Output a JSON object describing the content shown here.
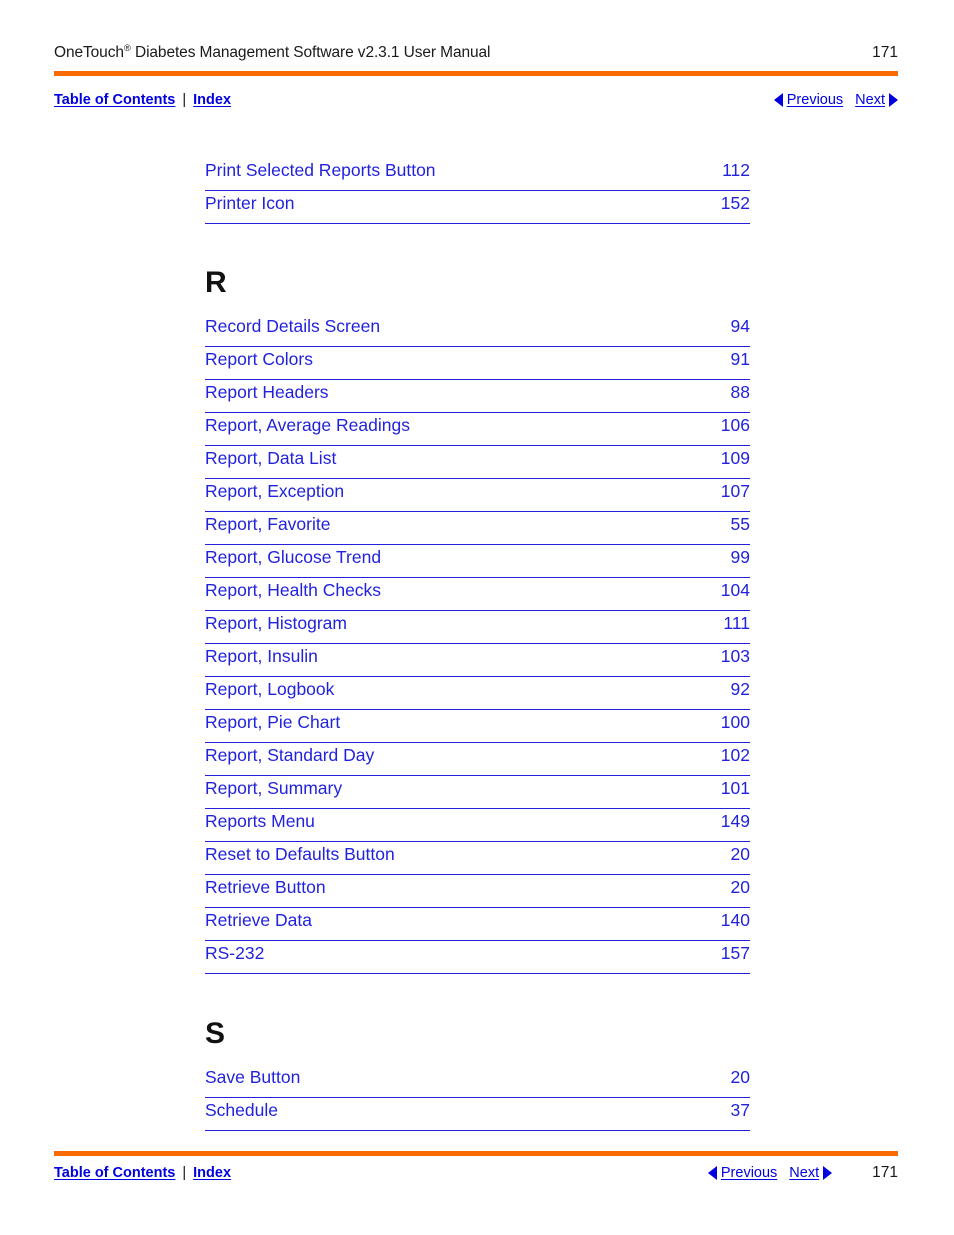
{
  "header": {
    "title_main": "OneTouch",
    "title_sup": "®",
    "title_rest": " Diabetes Management Software v2.3.1 User Manual",
    "page_number": "171"
  },
  "nav": {
    "toc_label": "Table of Contents",
    "separator": "|",
    "index_label": "Index",
    "previous_label": "Previous",
    "next_label": "Next",
    "prev_icon": "triangle-left-icon",
    "next_icon": "triangle-right-icon"
  },
  "footer": {
    "toc_label": "Table of Contents",
    "separator": "|",
    "index_label": "Index",
    "previous_label": "Previous",
    "next_label": "Next",
    "page_number": "171"
  },
  "colors": {
    "rule_orange": "#f96a00",
    "entry_blue": "#2222dd",
    "link_blue": "#0000e0",
    "text_black": "#1a1a1a"
  },
  "index": {
    "leading_entries": [
      {
        "label": "Print Selected Reports Button",
        "page": "112"
      },
      {
        "label": "Printer Icon",
        "page": "152"
      }
    ],
    "sections": [
      {
        "letter": "R",
        "entries": [
          {
            "label": "Record Details Screen",
            "page": "94"
          },
          {
            "label": "Report Colors",
            "page": "91"
          },
          {
            "label": "Report Headers",
            "page": "88"
          },
          {
            "label": "Report, Average Readings",
            "page": "106"
          },
          {
            "label": "Report, Data List",
            "page": "109"
          },
          {
            "label": "Report, Exception",
            "page": "107"
          },
          {
            "label": "Report, Favorite",
            "page": "55"
          },
          {
            "label": "Report, Glucose Trend",
            "page": "99"
          },
          {
            "label": "Report, Health Checks",
            "page": "104"
          },
          {
            "label": "Report, Histogram",
            "page": "111"
          },
          {
            "label": "Report, Insulin",
            "page": "103"
          },
          {
            "label": "Report, Logbook",
            "page": "92"
          },
          {
            "label": "Report, Pie Chart",
            "page": "100"
          },
          {
            "label": "Report, Standard Day",
            "page": "102"
          },
          {
            "label": "Report, Summary",
            "page": "101"
          },
          {
            "label": "Reports Menu",
            "page": "149"
          },
          {
            "label": "Reset to Defaults Button",
            "page": "20"
          },
          {
            "label": "Retrieve Button",
            "page": "20"
          },
          {
            "label": "Retrieve Data",
            "page": "140"
          },
          {
            "label": "RS-232",
            "page": "157"
          }
        ]
      },
      {
        "letter": "S",
        "entries": [
          {
            "label": "Save Button",
            "page": "20"
          },
          {
            "label": "Schedule",
            "page": "37"
          }
        ]
      }
    ]
  }
}
